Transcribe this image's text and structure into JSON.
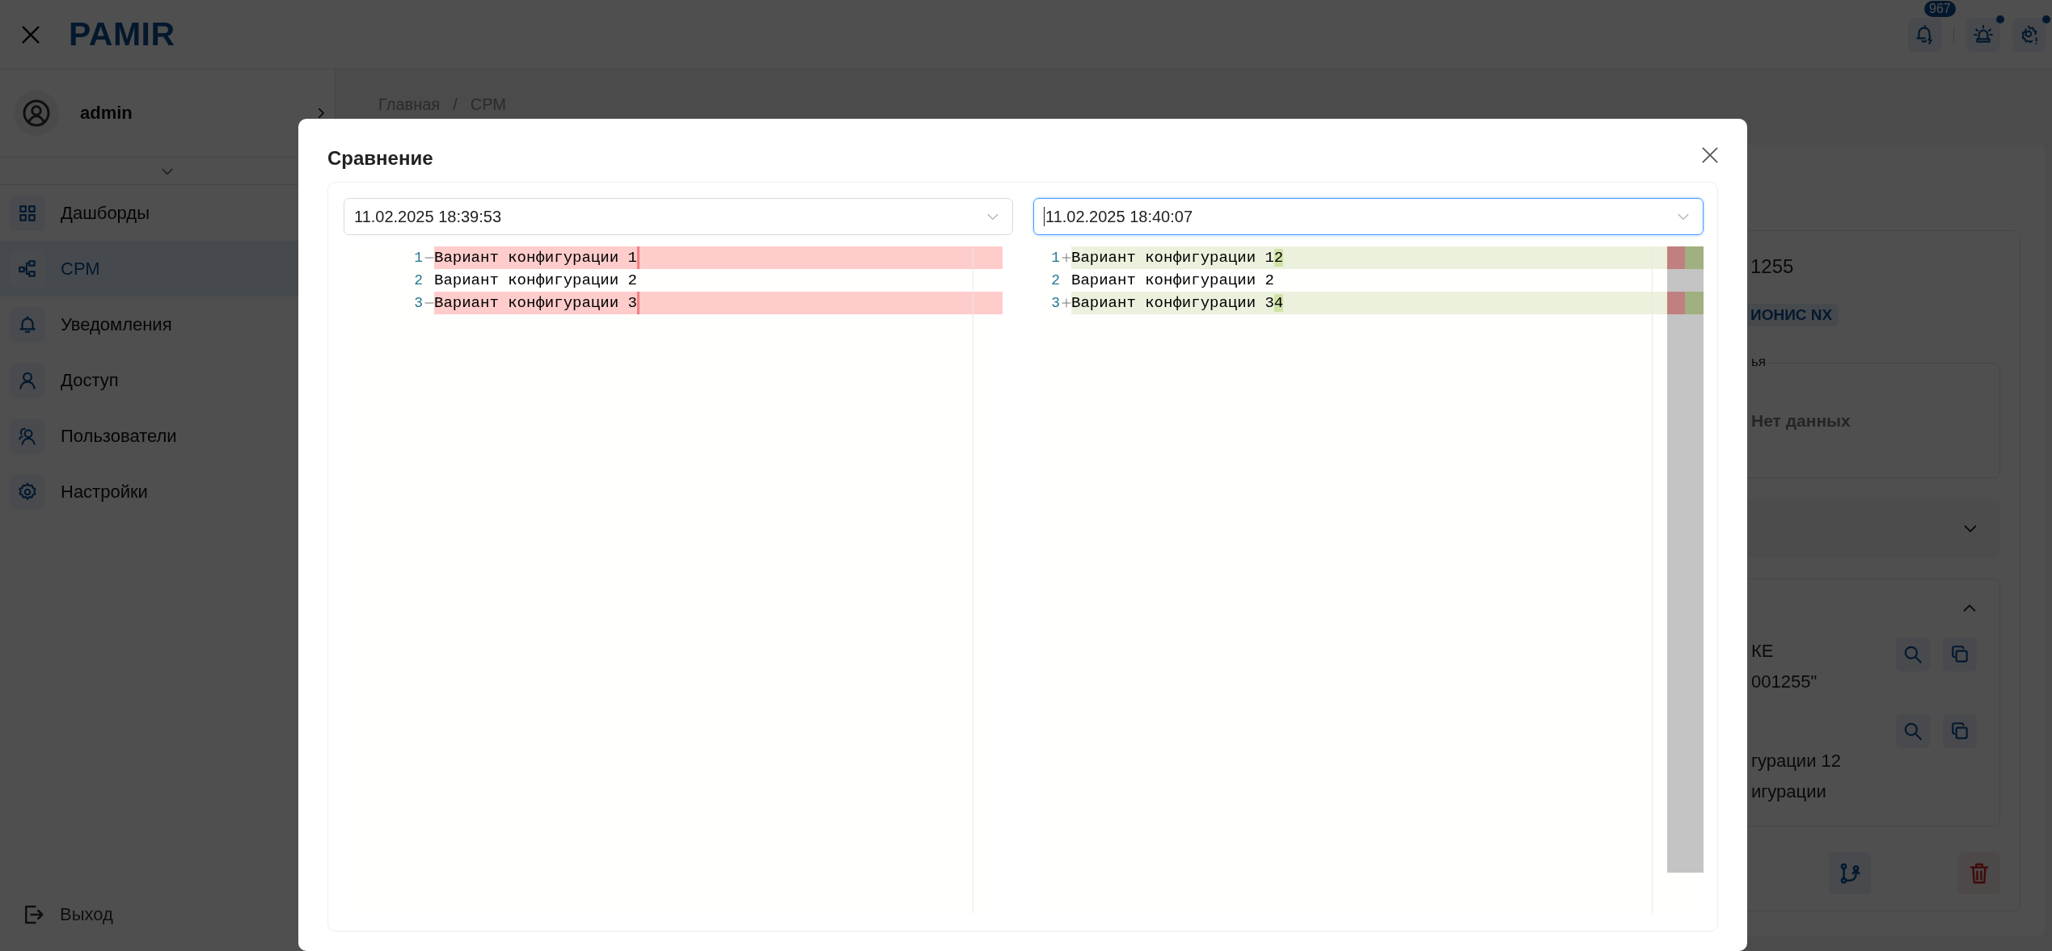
{
  "header": {
    "logo": "PAMIR",
    "notification_count": "967"
  },
  "sidebar": {
    "user": "admin",
    "items": [
      {
        "label": "Дашборды",
        "selected": false
      },
      {
        "label": "СРМ",
        "selected": true
      },
      {
        "label": "Уведомления",
        "selected": false
      },
      {
        "label": "Доступ",
        "selected": false
      },
      {
        "label": "Пользователи",
        "selected": false
      },
      {
        "label": "Настройки",
        "selected": false
      }
    ],
    "logout": "Выход"
  },
  "breadcrumb": {
    "items": [
      "Главная",
      "СРМ"
    ],
    "separator": "/"
  },
  "card": {
    "title": "1255",
    "tag": "ИОНИС NX",
    "field_label": "ья",
    "empty_text": "Нет данных",
    "sections": [
      {
        "expanded": false
      },
      {
        "expanded": true,
        "entries": [
          {
            "lines": [
              "КЕ",
              "001255\""
            ]
          },
          {
            "lines": [
              "гурации 12",
              "игурации"
            ]
          }
        ]
      }
    ]
  },
  "dialog": {
    "title": "Сравнение",
    "panes": [
      {
        "version": "11.02.2025 18:39:53",
        "focused": false,
        "lines": [
          {
            "number": "1",
            "kind": "removed",
            "text": "Вариант конфигурации 1"
          },
          {
            "number": "2",
            "kind": "unchanged",
            "text": "Вариант конфигурации 2"
          },
          {
            "number": "3",
            "kind": "removed",
            "text": "Вариант конфигурации 3"
          }
        ]
      },
      {
        "version": "11.02.2025 18:40:07",
        "focused": true,
        "lines": [
          {
            "number": "1",
            "kind": "added",
            "text": "Вариант конфигурации 1",
            "inserted": "2"
          },
          {
            "number": "2",
            "kind": "unchanged",
            "text": "Вариант конфигурации 2"
          },
          {
            "number": "3",
            "kind": "added",
            "text": "Вариант конфигурации 3",
            "inserted": "4"
          }
        ]
      }
    ]
  }
}
